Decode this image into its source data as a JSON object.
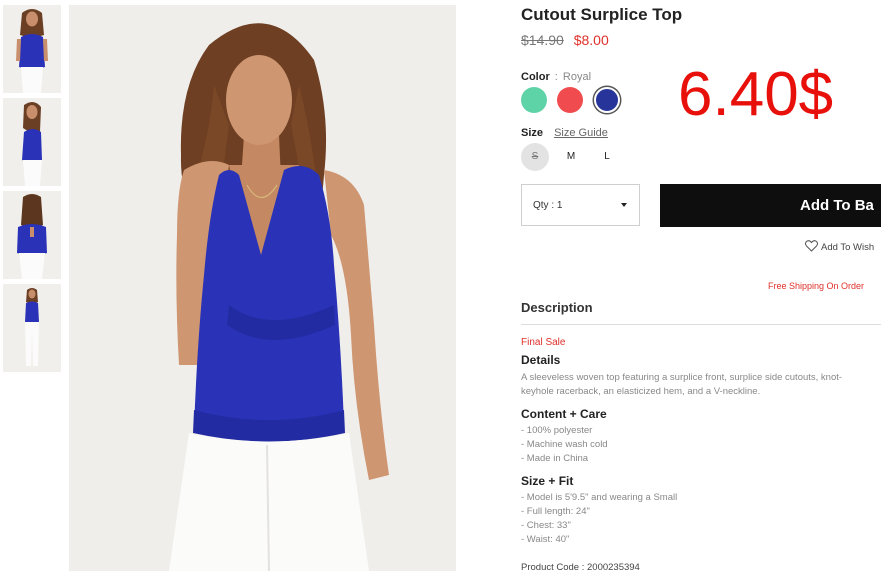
{
  "product": {
    "title": "Cutout Surplice Top",
    "price_original": "$14.90",
    "price_sale": "$8.00"
  },
  "overlay": {
    "price_text": "6.40$",
    "color": "#e8100b"
  },
  "color": {
    "label": "Color",
    "separator": ":",
    "selected": "Royal",
    "swatches": [
      {
        "name": "mint",
        "hex": "#5fd3a8",
        "icon": "color-swatch"
      },
      {
        "name": "coral",
        "hex": "#f04c4f",
        "icon": "color-swatch"
      },
      {
        "name": "royal",
        "hex": "#27359a",
        "icon": "color-swatch",
        "selected": true
      }
    ]
  },
  "size": {
    "label": "Size",
    "guide_label": "Size Guide",
    "options": [
      {
        "label": "S",
        "available": false
      },
      {
        "label": "M",
        "available": true
      },
      {
        "label": "L",
        "available": true
      }
    ]
  },
  "quantity": {
    "label": "Qty : 1"
  },
  "actions": {
    "add_to_bag": "Add To Ba",
    "add_to_wishlist": "Add To Wish",
    "wish_icon": "heart-outline-icon"
  },
  "shipping": {
    "note": "Free Shipping On Order"
  },
  "description": {
    "heading": "Description",
    "final_sale": "Final Sale",
    "details_heading": "Details",
    "details_lines": [
      "A sleeveless woven top featuring a surplice front, surplice side cutouts, knot-",
      "keyhole racerback, an elasticized hem, and a V-neckline."
    ],
    "content_heading": "Content + Care",
    "content_items": [
      "- 100% polyester",
      "- Machine wash cold",
      "- Made in China"
    ],
    "fit_heading": "Size + Fit",
    "fit_items": [
      "- Model is 5'9.5\" and wearing a Small",
      "- Full length: 24\"",
      "- Chest: 33\"",
      "- Waist: 40\""
    ],
    "product_code": "Product Code : 2000235394"
  },
  "colors": {
    "accent_red": "#e0302a",
    "button_black": "#0e0e0e",
    "garment_blue": "#2a33b8"
  }
}
